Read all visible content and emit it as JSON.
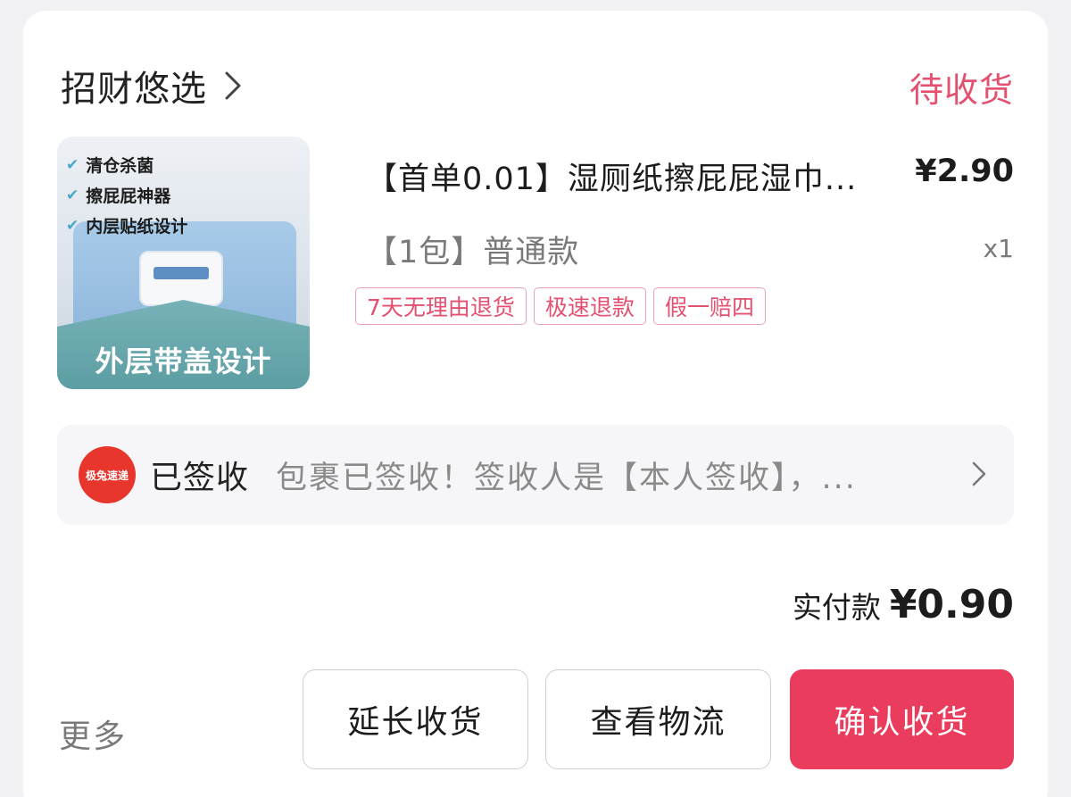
{
  "shop": {
    "name": "招财悠选",
    "status": "待收货"
  },
  "product": {
    "title": "【首单0.01】湿厕纸擦屁屁湿巾...",
    "price": "¥2.90",
    "variant": "【1包】普通款",
    "quantity": "x1",
    "image": {
      "features": [
        "清仓杀菌",
        "擦屁屁神器",
        "内层贴纸设计"
      ],
      "banner": "外层带盖设计"
    },
    "tags": [
      "7天无理由退货",
      "极速退款",
      "假一赔四"
    ]
  },
  "logistics": {
    "courier_logo_text": "极兔速递",
    "status": "已签收",
    "detail": "包裹已签收！签收人是【本人签收】，..."
  },
  "payment": {
    "label": "实付款",
    "amount": "¥0.90"
  },
  "actions": {
    "more": "更多",
    "extend": "延长收货",
    "track": "查看物流",
    "confirm": "确认收货"
  },
  "colors": {
    "accent": "#ea3c5c",
    "status": "#e4506f",
    "courier": "#e8362d"
  }
}
